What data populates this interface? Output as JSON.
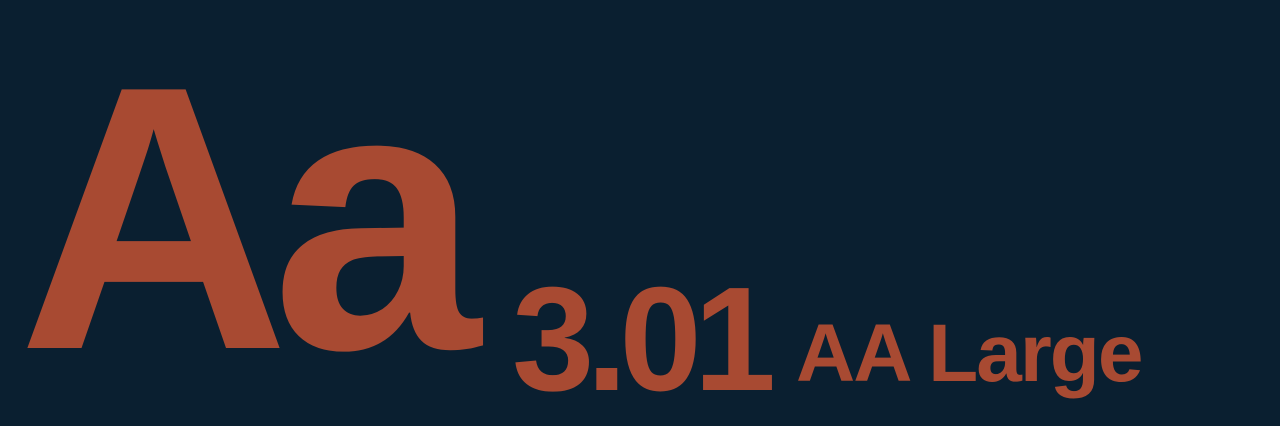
{
  "swatch": {
    "sample_text": "Aa",
    "contrast_ratio": "3.01",
    "rating": "AA Large",
    "background_color": "#0a1f30",
    "foreground_color": "#a84a32"
  }
}
